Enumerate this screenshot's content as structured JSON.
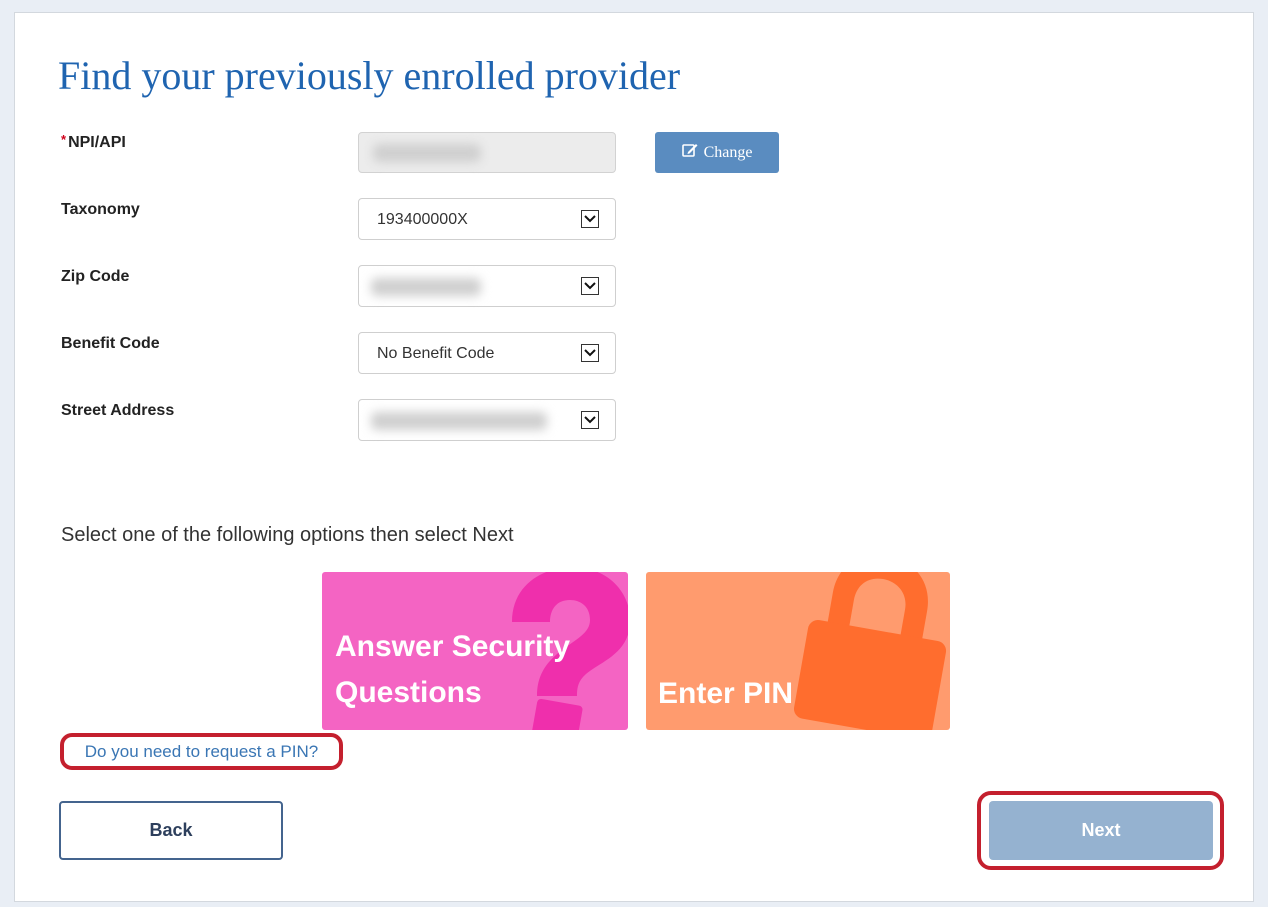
{
  "page": {
    "title": "Find your previously enrolled provider"
  },
  "fields": {
    "npi": {
      "required_marker": "*",
      "label": "NPI/API",
      "value_redacted": true
    },
    "change_button": {
      "label": "Change",
      "icon": "edit-icon"
    },
    "taxonomy": {
      "label": "Taxonomy",
      "value": "193400000X"
    },
    "zip_code": {
      "label": "Zip Code",
      "value_redacted": true
    },
    "benefit_code": {
      "label": "Benefit Code",
      "value": "No Benefit Code"
    },
    "street_address": {
      "label": "Street Address",
      "value_redacted": true
    }
  },
  "options": {
    "instructions": "Select one of the following options then select Next",
    "tiles": [
      {
        "label_line1": "Answer Security",
        "label_line2": "Questions",
        "icon": "question-mark-icon",
        "color": "#f464c3"
      },
      {
        "label": "Enter PIN",
        "icon": "lock-icon",
        "color": "#ff9b6e"
      }
    ]
  },
  "links": {
    "request_pin": "Do you need to request a PIN?"
  },
  "buttons": {
    "back": "Back",
    "next": "Next"
  },
  "colors": {
    "title": "#1f64b0",
    "primary": "#5a8cc0",
    "next_disabled": "#95b2d0",
    "highlight": "#c4202e"
  }
}
